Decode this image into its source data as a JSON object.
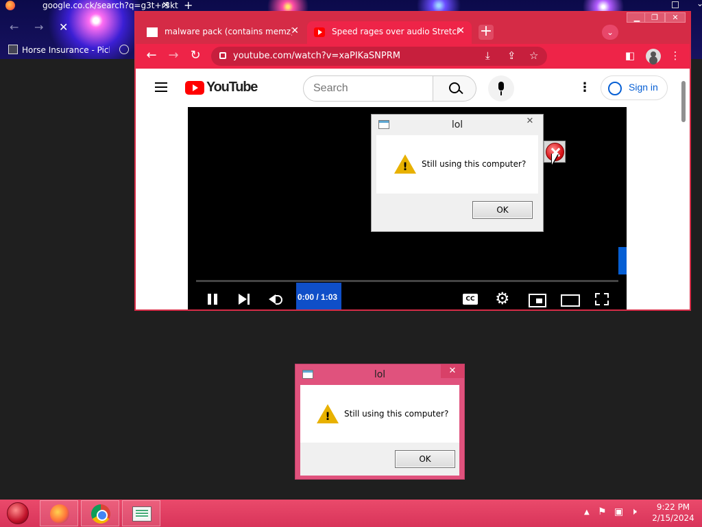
{
  "desktop": {
    "firefox_tab_title": "google.co.ck/search?q=g3t+r3kt",
    "firefox_bookmark": "Horse Insurance - Pick..."
  },
  "chrome": {
    "tabs": [
      {
        "title": "malware pack (contains memz) :",
        "icon": "archive-icon",
        "active": false
      },
      {
        "title": "Speed rages over audio Stretch c",
        "icon": "youtube-icon",
        "active": true
      }
    ],
    "url": "youtube.com/watch?v=xaPIKaSNPRM",
    "window_controls": [
      "minimize",
      "maximize",
      "close"
    ],
    "accent_color": "#ee2448"
  },
  "youtube": {
    "logo_text": "YouTube",
    "search_placeholder": "Search",
    "signin_label": "Sign in",
    "time_display": "0:00 / 1:03"
  },
  "dialogs": [
    {
      "title": "lol",
      "message": "Still using this computer?",
      "ok_label": "OK",
      "close_label": "✕"
    },
    {
      "title": "lol",
      "message": "Still using this computer?",
      "ok_label": "OK",
      "close_label": "✕"
    }
  ],
  "taskbar": {
    "apps": [
      "firefox-icon",
      "chrome-icon",
      "notepad-icon"
    ],
    "time": "9:22 PM",
    "date": "2/15/2024",
    "color": "#e0406a"
  }
}
